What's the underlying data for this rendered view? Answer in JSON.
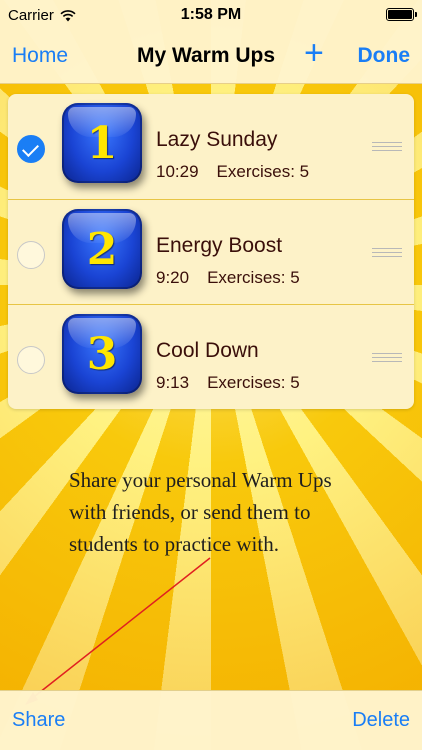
{
  "status_bar": {
    "carrier": "Carrier",
    "time": "1:58 PM"
  },
  "nav": {
    "back_label": "Home",
    "title": "My Warm Ups",
    "add_label": "+",
    "done_label": "Done"
  },
  "warmups": [
    {
      "number": "1",
      "name": "Lazy Sunday",
      "duration": "10:29",
      "exercises": "Exercises: 5",
      "selected": true
    },
    {
      "number": "2",
      "name": "Energy Boost",
      "duration": "9:20",
      "exercises": "Exercises: 5",
      "selected": false
    },
    {
      "number": "3",
      "name": "Cool Down",
      "duration": "9:13",
      "exercises": "Exercises: 5",
      "selected": false
    }
  ],
  "caption": {
    "line1": "Share your personal Warm Ups",
    "line2": "with friends, or send them to",
    "line3": "students to practice with."
  },
  "toolbar": {
    "share_label": "Share",
    "delete_label": "Delete"
  },
  "colors": {
    "accent": "#1a7ef5",
    "arrow": "#e02020",
    "text_dark": "#3a0f0a"
  },
  "icons": [
    "wifi-icon",
    "battery-icon",
    "checkmark-icon",
    "drag-handle-icon"
  ]
}
